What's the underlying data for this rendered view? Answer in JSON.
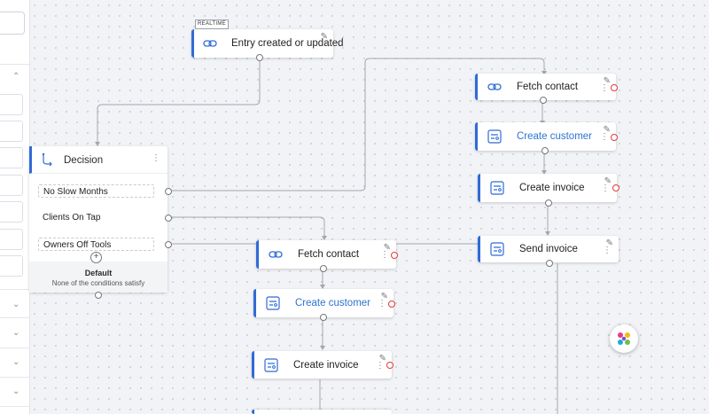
{
  "trigger": {
    "tag": "REALTIME",
    "label": "Entry created or updated"
  },
  "decision": {
    "title": "Decision",
    "conditions": [
      "No Slow Months",
      "Clients On Tap",
      "Owners Off Tools"
    ],
    "default_title": "Default",
    "default_subtitle": "None of the conditions satisfy"
  },
  "branch_right": {
    "fetch": "Fetch contact",
    "create_customer": "Create customer",
    "create_invoice": "Create invoice",
    "send_invoice": "Send invoice"
  },
  "branch_center": {
    "fetch": "Fetch contact",
    "create_customer": "Create customer",
    "create_invoice": "Create invoice"
  },
  "colors": {
    "accent": "#2f6bd6",
    "link": "#2f74d0",
    "error_port": "#e23a3a"
  },
  "icons": [
    "link-icon",
    "decision-icon",
    "module-icon",
    "pencil-icon",
    "kebab-icon",
    "chevron-up-icon",
    "chevron-down-icon",
    "plus-icon"
  ]
}
